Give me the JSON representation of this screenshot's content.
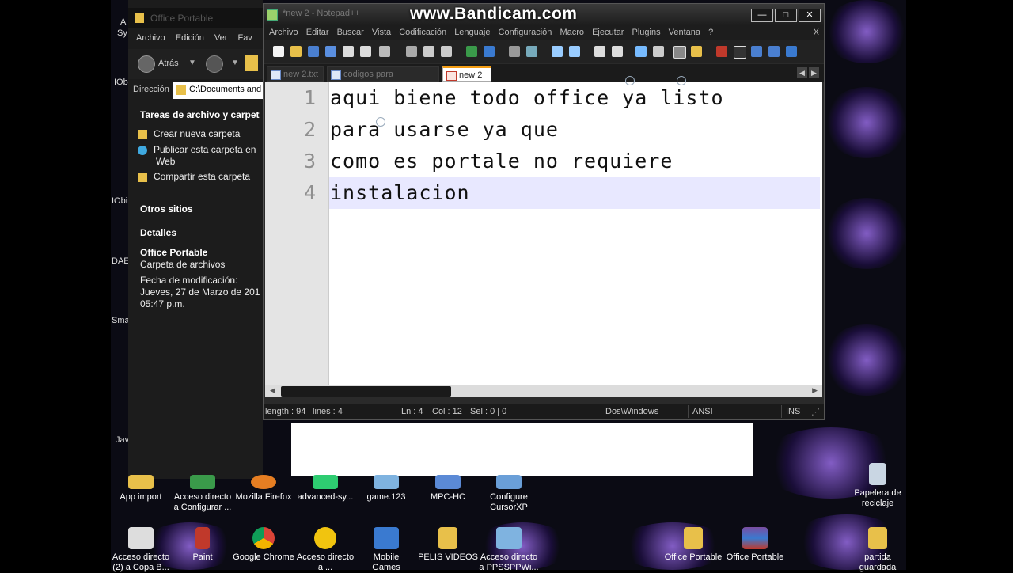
{
  "watermark": "www.Bandicam.com",
  "explorer": {
    "title": "Office Portable",
    "menu": [
      "Archivo",
      "Edición",
      "Ver",
      "Fav"
    ],
    "nav": {
      "back_label": "Atrás"
    },
    "address": {
      "label": "Dirección",
      "value": "C:\\Documents and"
    },
    "tasks_header": "Tareas de archivo y carpet",
    "tasks": [
      "Crear nueva carpeta",
      "Publicar esta carpeta en",
      "Web",
      "Compartir esta carpeta"
    ],
    "other_sites": "Otros sitios",
    "details_header": "Detalles",
    "details_name": "Office Portable",
    "details_type": "Carpeta de archivos",
    "details_date_label": "Fecha de modificación:",
    "details_date": "Jueves, 27 de Marzo de 201",
    "details_time": "05:47 p.m."
  },
  "npp": {
    "title": "*new 2 - Notepad++",
    "menu": [
      "Archivo",
      "Editar",
      "Buscar",
      "Vista",
      "Codificación",
      "Lenguaje",
      "Configuración",
      "Macro",
      "Ejecutar",
      "Plugins",
      "Ventana",
      "?"
    ],
    "menu_close": "X",
    "window_buttons": {
      "minimize": "—",
      "maximize": "□",
      "close": "✕"
    },
    "tabs": [
      "new 2.txt",
      "codigos para cursorxp.txt",
      "new 2"
    ],
    "lines": [
      "aqui biene todo office ya listo",
      "para usarse ya que",
      "como es portale no requiere",
      "instalacion"
    ],
    "line_numbers": [
      "1",
      "2",
      "3",
      "4"
    ],
    "status": {
      "length": "length : 94",
      "lines": "lines : 4",
      "ln": "Ln : 4",
      "col": "Col : 12",
      "sel": "Sel : 0 | 0",
      "eol": "Dos\\Windows",
      "encoding": "ANSI",
      "mode": "INS"
    }
  },
  "desktop": {
    "left_edge": [
      "A",
      "Sy",
      "IOb",
      "IObit",
      "DAE",
      "Sma",
      "Jav"
    ],
    "row1": [
      "App import",
      "Acceso directo\na Configurar ...",
      "Mozilla Firefox",
      "advanced-sy...",
      "game.123",
      "MPC-HC",
      "Configure\nCursorXP",
      "",
      "",
      "",
      "",
      "Papelera de\nreciclaje"
    ],
    "row2": [
      "Acceso directo\n(2) a Copa B...",
      "Paint",
      "Google Chrome",
      "Acceso directo\na ...",
      "Mobile\nGames",
      "PELIS VIDEOS",
      "Acceso directo\na PPSSPPWi...",
      "",
      "Office Portable",
      "Office Portable",
      "",
      "partida\nguardada"
    ]
  },
  "colors": {
    "desktop_bg": "#0b0b14",
    "glow": "#8a5cf0",
    "folder": "#e8c04a",
    "tab_accent": "#f39c12"
  }
}
